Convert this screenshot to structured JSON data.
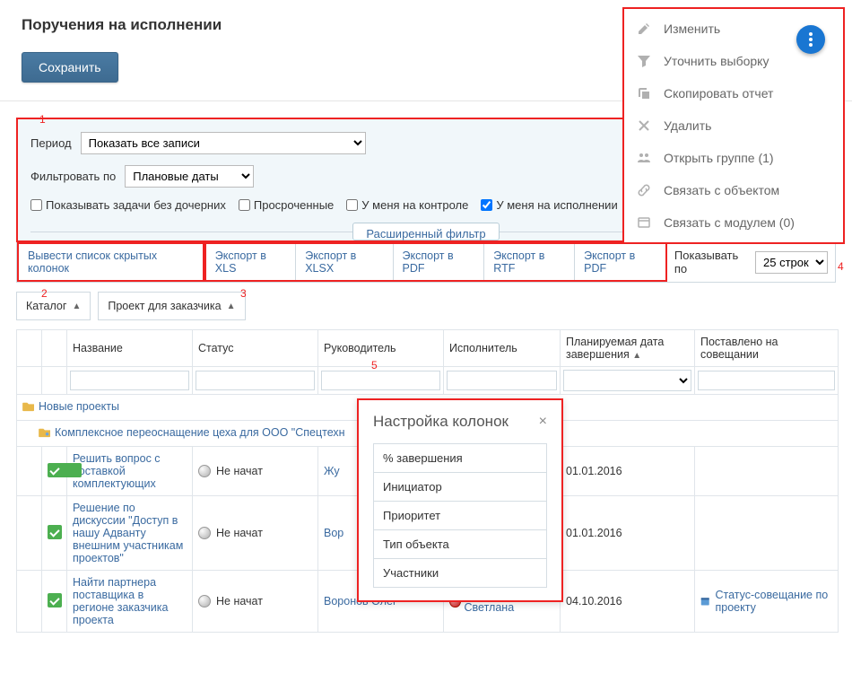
{
  "page": {
    "title": "Поручения на исполнении",
    "save": "Сохранить"
  },
  "annotations": {
    "a1": "1",
    "a2": "2",
    "a3": "3",
    "a4": "4",
    "a5": "5"
  },
  "ctx": {
    "edit": "Изменить",
    "refine": "Уточнить выборку",
    "copy": "Скопировать отчет",
    "delete": "Удалить",
    "openGroup": "Открыть группе (1)",
    "linkObj": "Связать с объектом",
    "linkMod": "Связать с модулем (0)"
  },
  "filters": {
    "periodLabel": "Период",
    "periodValue": "Показать все записи",
    "filterByLabel": "Фильтровать по",
    "filterByValue": "Плановые даты",
    "c1": "Показывать задачи без дочерних",
    "c2": "Просроченные",
    "c3": "У меня на контроле",
    "c4": "У меня на исполнении",
    "advanced": "Расширенный фильтр"
  },
  "toolbar": {
    "hiddenCols": "Вывести список скрытых колонок",
    "xls": "Экспорт в XLS",
    "xlsx": "Экспорт в XLSX",
    "pdf1": "Экспорт в PDF",
    "rtf": "Экспорт в RTF",
    "pdf2": "Экспорт в PDF",
    "showByLabel": "Показывать по",
    "showByValue": "25 строк"
  },
  "groupHeaders": {
    "g1": "Каталог",
    "g2": "Проект для заказчика"
  },
  "cols": {
    "name": "Название",
    "status": "Статус",
    "lead": "Руководитель",
    "exec": "Исполнитель",
    "planEnd": "Планируемая дата завершения",
    "meeting": "Поставлено на совещании"
  },
  "groups": {
    "top": "Новые проекты",
    "sub": "Комплексное переоснащение цеха для ООО \"Спецтехн"
  },
  "rows": [
    {
      "name": "Решить вопрос с поставкой комплектующих",
      "status": "Не начат",
      "lead": "Жу",
      "exec": "",
      "date": "01.01.2016",
      "meeting": ""
    },
    {
      "name": "Решение по дискуссии \"Доступ в нашу Адванту внешним участникам проектов\"",
      "status": "Не начат",
      "lead": "Вор",
      "exec": "",
      "date": "01.01.2016",
      "meeting": ""
    },
    {
      "name": "Найти партнера поставщика в регионе заказчика проекта",
      "status": "Не начат",
      "lead": "Воронов Олег",
      "exec": "Ковалева Светлана",
      "date": "04.10.2016",
      "meeting": "Статус-совещание по проекту"
    }
  ],
  "popup": {
    "title": "Настройка колонок",
    "items": [
      "% завершения",
      "Инициатор",
      "Приоритет",
      "Тип объекта",
      "Участники"
    ]
  },
  "chart_data": {
    "type": "table"
  }
}
